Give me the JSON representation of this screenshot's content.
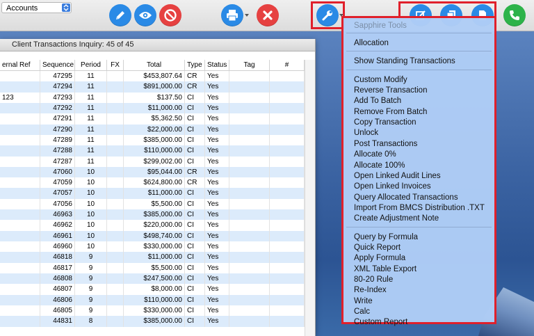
{
  "toolbar": {
    "account_select_value": "Accounts",
    "buttons": [
      {
        "name": "edit-button",
        "icon": "pencil-icon"
      },
      {
        "name": "view-button",
        "icon": "eye-icon"
      },
      {
        "name": "prohibit-button",
        "icon": "prohibit-icon"
      },
      {
        "name": "print-button",
        "icon": "printer-icon"
      },
      {
        "name": "delete-button",
        "icon": "x-icon"
      },
      {
        "name": "tools-button",
        "icon": "wrench-icon"
      },
      {
        "name": "edit-doc-button",
        "icon": "edit-document-icon"
      },
      {
        "name": "copy-doc-button",
        "icon": "copy-document-icon"
      },
      {
        "name": "document-button",
        "icon": "document-icon"
      },
      {
        "name": "call-button",
        "icon": "phone-icon"
      }
    ]
  },
  "window": {
    "title": "Client Transactions Inquiry: 45 of 45"
  },
  "table": {
    "columns": [
      "ernal Ref",
      "Sequence",
      "Period",
      "FX",
      "Total",
      "Type",
      "Status",
      "Tag",
      "#"
    ],
    "rows": [
      {
        "ref": "",
        "seq": "47295",
        "period": "11",
        "fx": "",
        "total": "$453,807.64",
        "type": "CR",
        "status": "Yes"
      },
      {
        "ref": "",
        "seq": "47294",
        "period": "11",
        "fx": "",
        "total": "$891,000.00",
        "type": "CR",
        "status": "Yes"
      },
      {
        "ref": "123",
        "seq": "47293",
        "period": "11",
        "fx": "",
        "total": "$137.50",
        "type": "CI",
        "status": "Yes"
      },
      {
        "ref": "",
        "seq": "47292",
        "period": "11",
        "fx": "",
        "total": "$11,000.00",
        "type": "CI",
        "status": "Yes"
      },
      {
        "ref": "",
        "seq": "47291",
        "period": "11",
        "fx": "",
        "total": "$5,362.50",
        "type": "CI",
        "status": "Yes"
      },
      {
        "ref": "",
        "seq": "47290",
        "period": "11",
        "fx": "",
        "total": "$22,000.00",
        "type": "CI",
        "status": "Yes"
      },
      {
        "ref": "",
        "seq": "47289",
        "period": "11",
        "fx": "",
        "total": "$385,000.00",
        "type": "CI",
        "status": "Yes"
      },
      {
        "ref": "",
        "seq": "47288",
        "period": "11",
        "fx": "",
        "total": "$110,000.00",
        "type": "CI",
        "status": "Yes"
      },
      {
        "ref": "",
        "seq": "47287",
        "period": "11",
        "fx": "",
        "total": "$299,002.00",
        "type": "CI",
        "status": "Yes"
      },
      {
        "ref": "",
        "seq": "47060",
        "period": "10",
        "fx": "",
        "total": "$95,044.00",
        "type": "CR",
        "status": "Yes"
      },
      {
        "ref": "",
        "seq": "47059",
        "period": "10",
        "fx": "",
        "total": "$624,800.00",
        "type": "CR",
        "status": "Yes"
      },
      {
        "ref": "",
        "seq": "47057",
        "period": "10",
        "fx": "",
        "total": "$11,000.00",
        "type": "CI",
        "status": "Yes"
      },
      {
        "ref": "",
        "seq": "47056",
        "period": "10",
        "fx": "",
        "total": "$5,500.00",
        "type": "CI",
        "status": "Yes"
      },
      {
        "ref": "",
        "seq": "46963",
        "period": "10",
        "fx": "",
        "total": "$385,000.00",
        "type": "CI",
        "status": "Yes"
      },
      {
        "ref": "",
        "seq": "46962",
        "period": "10",
        "fx": "",
        "total": "$220,000.00",
        "type": "CI",
        "status": "Yes"
      },
      {
        "ref": "",
        "seq": "46961",
        "period": "10",
        "fx": "",
        "total": "$498,740.00",
        "type": "CI",
        "status": "Yes"
      },
      {
        "ref": "",
        "seq": "46960",
        "period": "10",
        "fx": "",
        "total": "$330,000.00",
        "type": "CI",
        "status": "Yes"
      },
      {
        "ref": "",
        "seq": "46818",
        "period": "9",
        "fx": "",
        "total": "$11,000.00",
        "type": "CI",
        "status": "Yes"
      },
      {
        "ref": "",
        "seq": "46817",
        "period": "9",
        "fx": "",
        "total": "$5,500.00",
        "type": "CI",
        "status": "Yes"
      },
      {
        "ref": "",
        "seq": "46808",
        "period": "9",
        "fx": "",
        "total": "$247,500.00",
        "type": "CI",
        "status": "Yes"
      },
      {
        "ref": "",
        "seq": "46807",
        "period": "9",
        "fx": "",
        "total": "$8,000.00",
        "type": "CI",
        "status": "Yes"
      },
      {
        "ref": "",
        "seq": "46806",
        "period": "9",
        "fx": "",
        "total": "$110,000.00",
        "type": "CI",
        "status": "Yes"
      },
      {
        "ref": "",
        "seq": "46805",
        "period": "9",
        "fx": "",
        "total": "$330,000.00",
        "type": "CI",
        "status": "Yes"
      },
      {
        "ref": "",
        "seq": "44831",
        "period": "8",
        "fx": "",
        "total": "$385,000.00",
        "type": "CI",
        "status": "Yes"
      }
    ]
  },
  "menu": {
    "header": "Sapphire Tools",
    "groups": [
      [
        "Allocation"
      ],
      [
        "Show Standing Transactions"
      ],
      [
        "Custom Modify",
        "Reverse Transaction",
        "Add To Batch",
        "Remove From Batch",
        "Copy Transaction",
        "Unlock",
        "Post Transactions",
        "Allocate 0%",
        "Allocate 100%",
        "Open Linked Audit Lines",
        "Open Linked Invoices",
        "Query Allocated Transactions",
        "Import From BMCS Distribution .TXT",
        "Create Adjustment Note"
      ],
      [
        "Query by Formula",
        "Quick Report",
        "Apply Formula",
        "XML Table Export",
        "80-20 Rule",
        "Re-Index",
        "Write",
        "Calc",
        "Custom Report"
      ]
    ]
  },
  "colors": {
    "accent_blue": "#2a8ae6",
    "danger_red": "#e64141",
    "call_green": "#2db34a",
    "highlight_border": "#e0202b",
    "menu_bg": "#b0cdf6",
    "row_alt": "#dcebfb"
  }
}
